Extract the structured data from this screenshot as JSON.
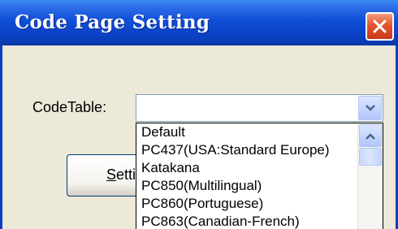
{
  "window": {
    "title": "Code Page Setting"
  },
  "form": {
    "codetable_label": "CodeTable:",
    "codetable_value": "",
    "setting_button_visible": "Setti"
  },
  "dropdown": {
    "items": [
      "Default",
      "PC437(USA:Standard Europe)",
      "Katakana",
      "PC850(Multilingual)",
      "PC860(Portuguese)",
      "PC863(Canadian-French)"
    ]
  },
  "colors": {
    "titlebar": "#0a3fc2",
    "close_button": "#e4562e",
    "dialog_background": "#ece9d8"
  },
  "icons": {
    "close": "close-icon",
    "dropdown": "chevron-down-icon",
    "scroll_up": "chevron-up-icon"
  }
}
